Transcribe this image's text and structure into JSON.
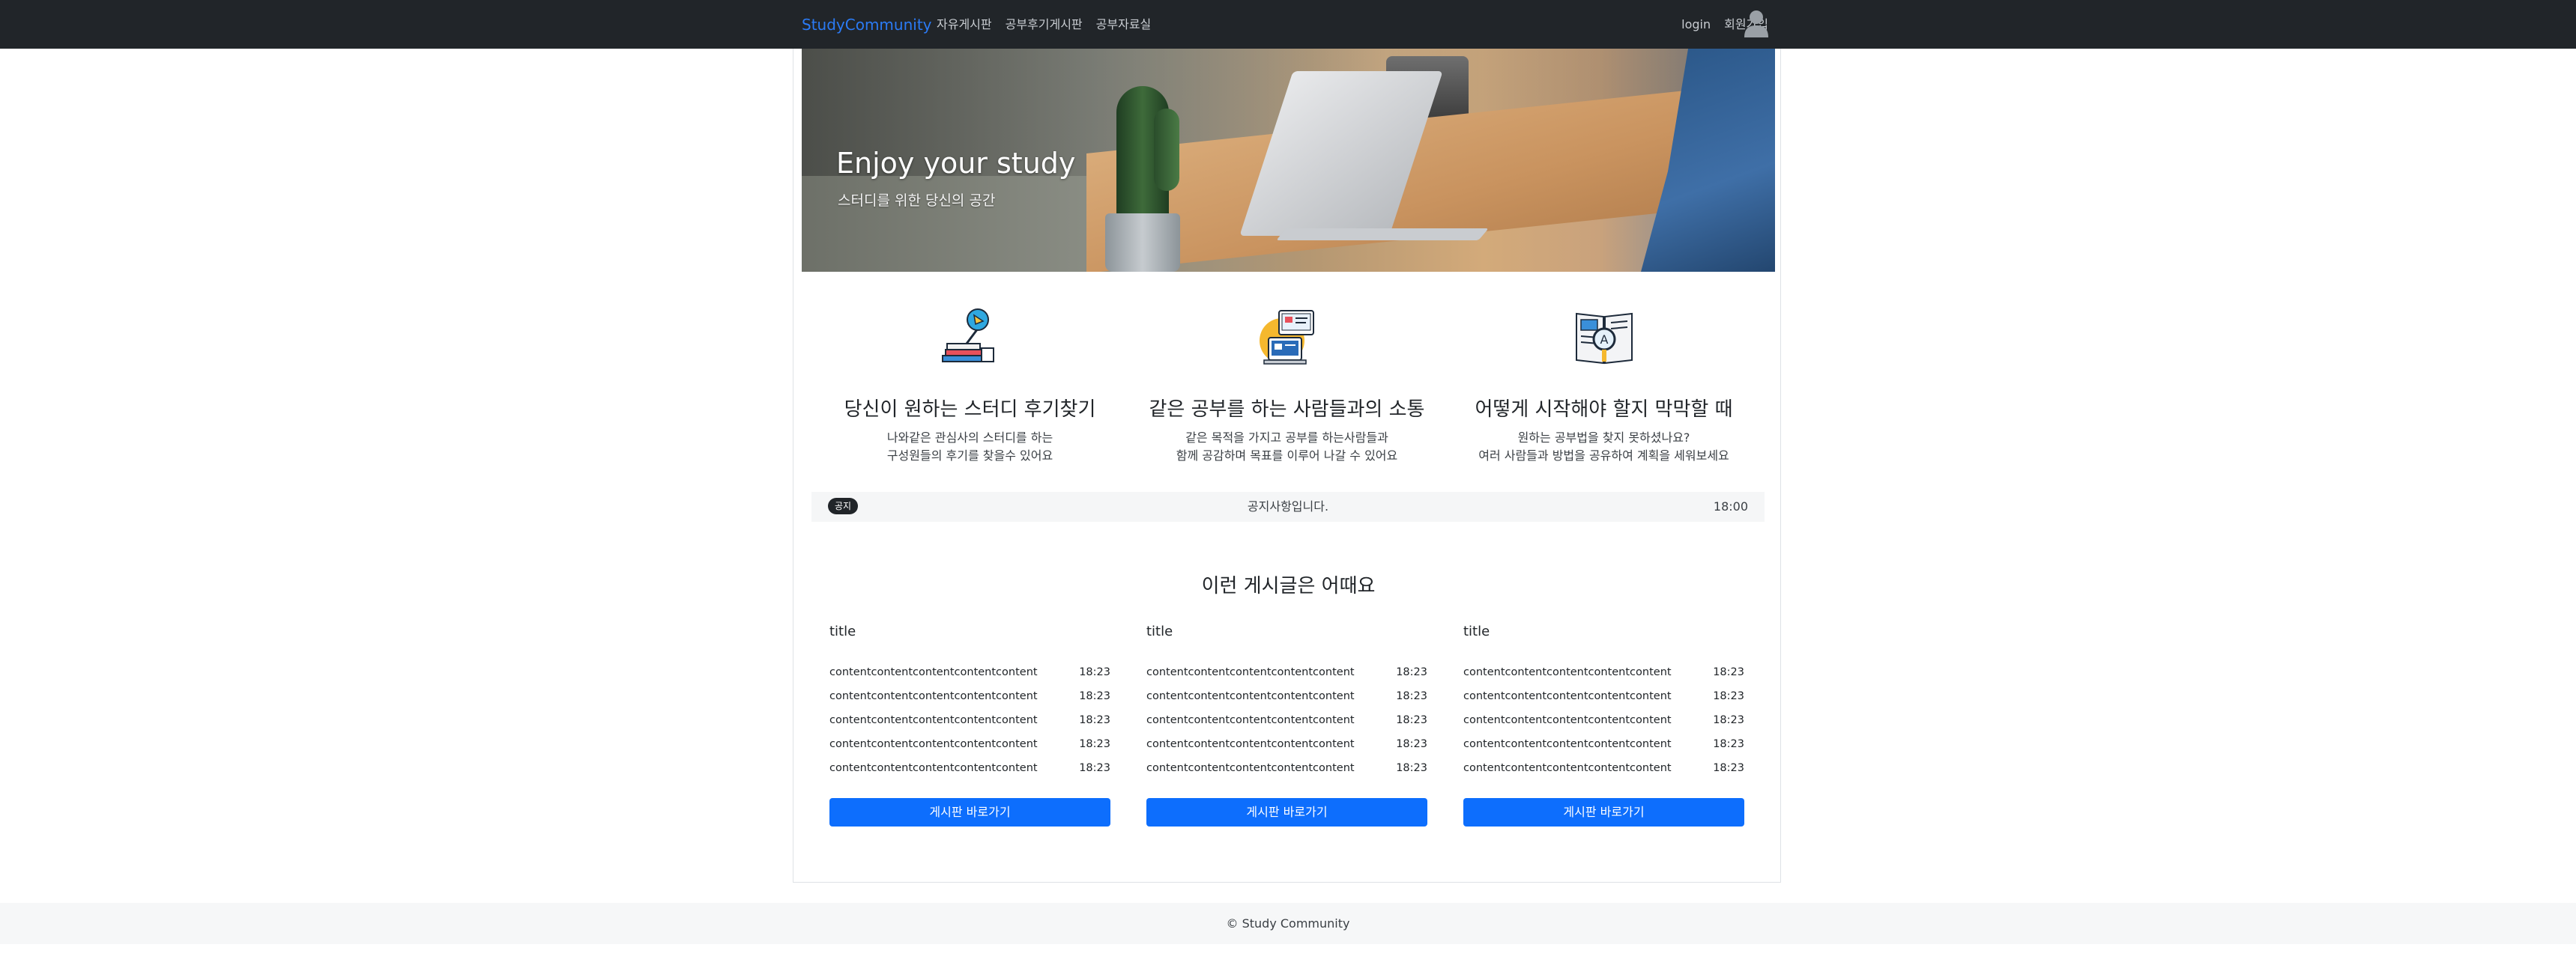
{
  "navbar": {
    "brand": "StudyCommunity",
    "links": [
      "자유게시판",
      "공부후기게시판",
      "공부자료실"
    ],
    "login": "login",
    "signup": "회원가입",
    "icons": {
      "user": "user-icon"
    }
  },
  "hero": {
    "title": "Enjoy your study",
    "subtitle": "스터디를 위한 당신의 공간"
  },
  "features": [
    {
      "icon": "study-lamp-books-icon",
      "title": "당신이 원하는 스터디 후기찾기",
      "desc_line1": "나와같은 관심사의 스터디를 하는",
      "desc_line2": "구성원들의 후기를 찾을수 있어요"
    },
    {
      "icon": "online-communication-icon",
      "title": "같은 공부를 하는 사람들과의 소통",
      "desc_line1": "같은 목적을 가지고 공부를 하는사람들과",
      "desc_line2": "함께 공감하며 목표를 이루어 나갈 수 있어요"
    },
    {
      "icon": "book-magnifier-icon",
      "title": "어떻게 시작해야 할지 막막할 때",
      "desc_line1": "원하는 공부법을 찾지 못하셨나요?",
      "desc_line2": "여러 사람들과 방법을 공유하여 계획을 세워보세요"
    }
  ],
  "notice": {
    "badge": "공지",
    "text": "공지사항입니다.",
    "time": "18:00"
  },
  "recommend": {
    "title": "이런 게시글은 어때요",
    "boards": [
      {
        "title": "title",
        "rows": [
          {
            "content": "contentcontentcontentcontentcontent",
            "time": "18:23"
          },
          {
            "content": "contentcontentcontentcontentcontent",
            "time": "18:23"
          },
          {
            "content": "contentcontentcontentcontentcontent",
            "time": "18:23"
          },
          {
            "content": "contentcontentcontentcontentcontent",
            "time": "18:23"
          },
          {
            "content": "contentcontentcontentcontentcontent",
            "time": "18:23"
          }
        ],
        "button": "게시판 바로가기"
      },
      {
        "title": "title",
        "rows": [
          {
            "content": "contentcontentcontentcontentcontent",
            "time": "18:23"
          },
          {
            "content": "contentcontentcontentcontentcontent",
            "time": "18:23"
          },
          {
            "content": "contentcontentcontentcontentcontent",
            "time": "18:23"
          },
          {
            "content": "contentcontentcontentcontentcontent",
            "time": "18:23"
          },
          {
            "content": "contentcontentcontentcontentcontent",
            "time": "18:23"
          }
        ],
        "button": "게시판 바로가기"
      },
      {
        "title": "title",
        "rows": [
          {
            "content": "contentcontentcontentcontentcontent",
            "time": "18:23"
          },
          {
            "content": "contentcontentcontentcontentcontent",
            "time": "18:23"
          },
          {
            "content": "contentcontentcontentcontentcontent",
            "time": "18:23"
          },
          {
            "content": "contentcontentcontentcontentcontent",
            "time": "18:23"
          },
          {
            "content": "contentcontentcontentcontentcontent",
            "time": "18:23"
          }
        ],
        "button": "게시판 바로가기"
      }
    ]
  },
  "footer": {
    "text": "© Study Community"
  },
  "colors": {
    "navbar": "#212529",
    "brand": "#2b7bf5",
    "button": "#0d6efd",
    "footer": "#f6f7f8"
  }
}
